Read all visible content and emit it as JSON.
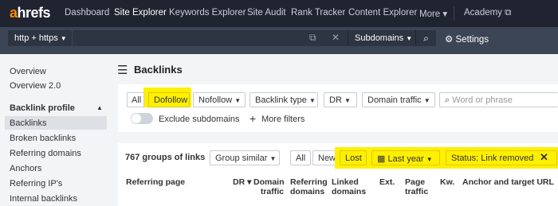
{
  "nav": {
    "logo": "hrefs",
    "logo_a": "a",
    "items": [
      "Dashboard",
      "Site Explorer",
      "Keywords Explorer",
      "Site Audit",
      "Rank Tracker",
      "Content Explorer",
      "More ▾",
      "Academy ⧉"
    ]
  },
  "toolbar": {
    "protocol": "http + https",
    "mode": "Subdomains",
    "settings": "Settings"
  },
  "sidebar": {
    "items": [
      "Overview",
      "Overview 2.0"
    ],
    "section": "Backlink profile",
    "section_items": [
      "Backlinks",
      "Broken backlinks",
      "Referring domains",
      "Anchors",
      "Referring IP's",
      "Internal backlinks"
    ]
  },
  "page": {
    "title": "Backlinks"
  },
  "filters": {
    "all": "All",
    "dofollow": "Dofollow",
    "nofollow": "Nofollow",
    "backlink_type": "Backlink type",
    "dr": "DR",
    "domain_traffic": "Domain traffic",
    "search_placeholder": "Word or phrase",
    "exclude_subdomains": "Exclude subdomains",
    "more_filters": "More filters"
  },
  "results": {
    "count_label": "767 groups of links",
    "group": "Group similar",
    "all": "All",
    "new": "New",
    "lost": "Lost",
    "period": "Last year",
    "status": "Status: Link removed"
  },
  "table": {
    "columns": [
      "Referring page",
      "DR ▾",
      "Domain traffic",
      "Referring domains",
      "Linked domains",
      "Ext.",
      "Page traffic",
      "Kw.",
      "Anchor and target URL"
    ]
  },
  "colors": {
    "nav_bg": "#1f2430",
    "toolbar_bg": "#3c4556",
    "highlight": "#ffef00",
    "logo_accent": "#ff8800"
  }
}
